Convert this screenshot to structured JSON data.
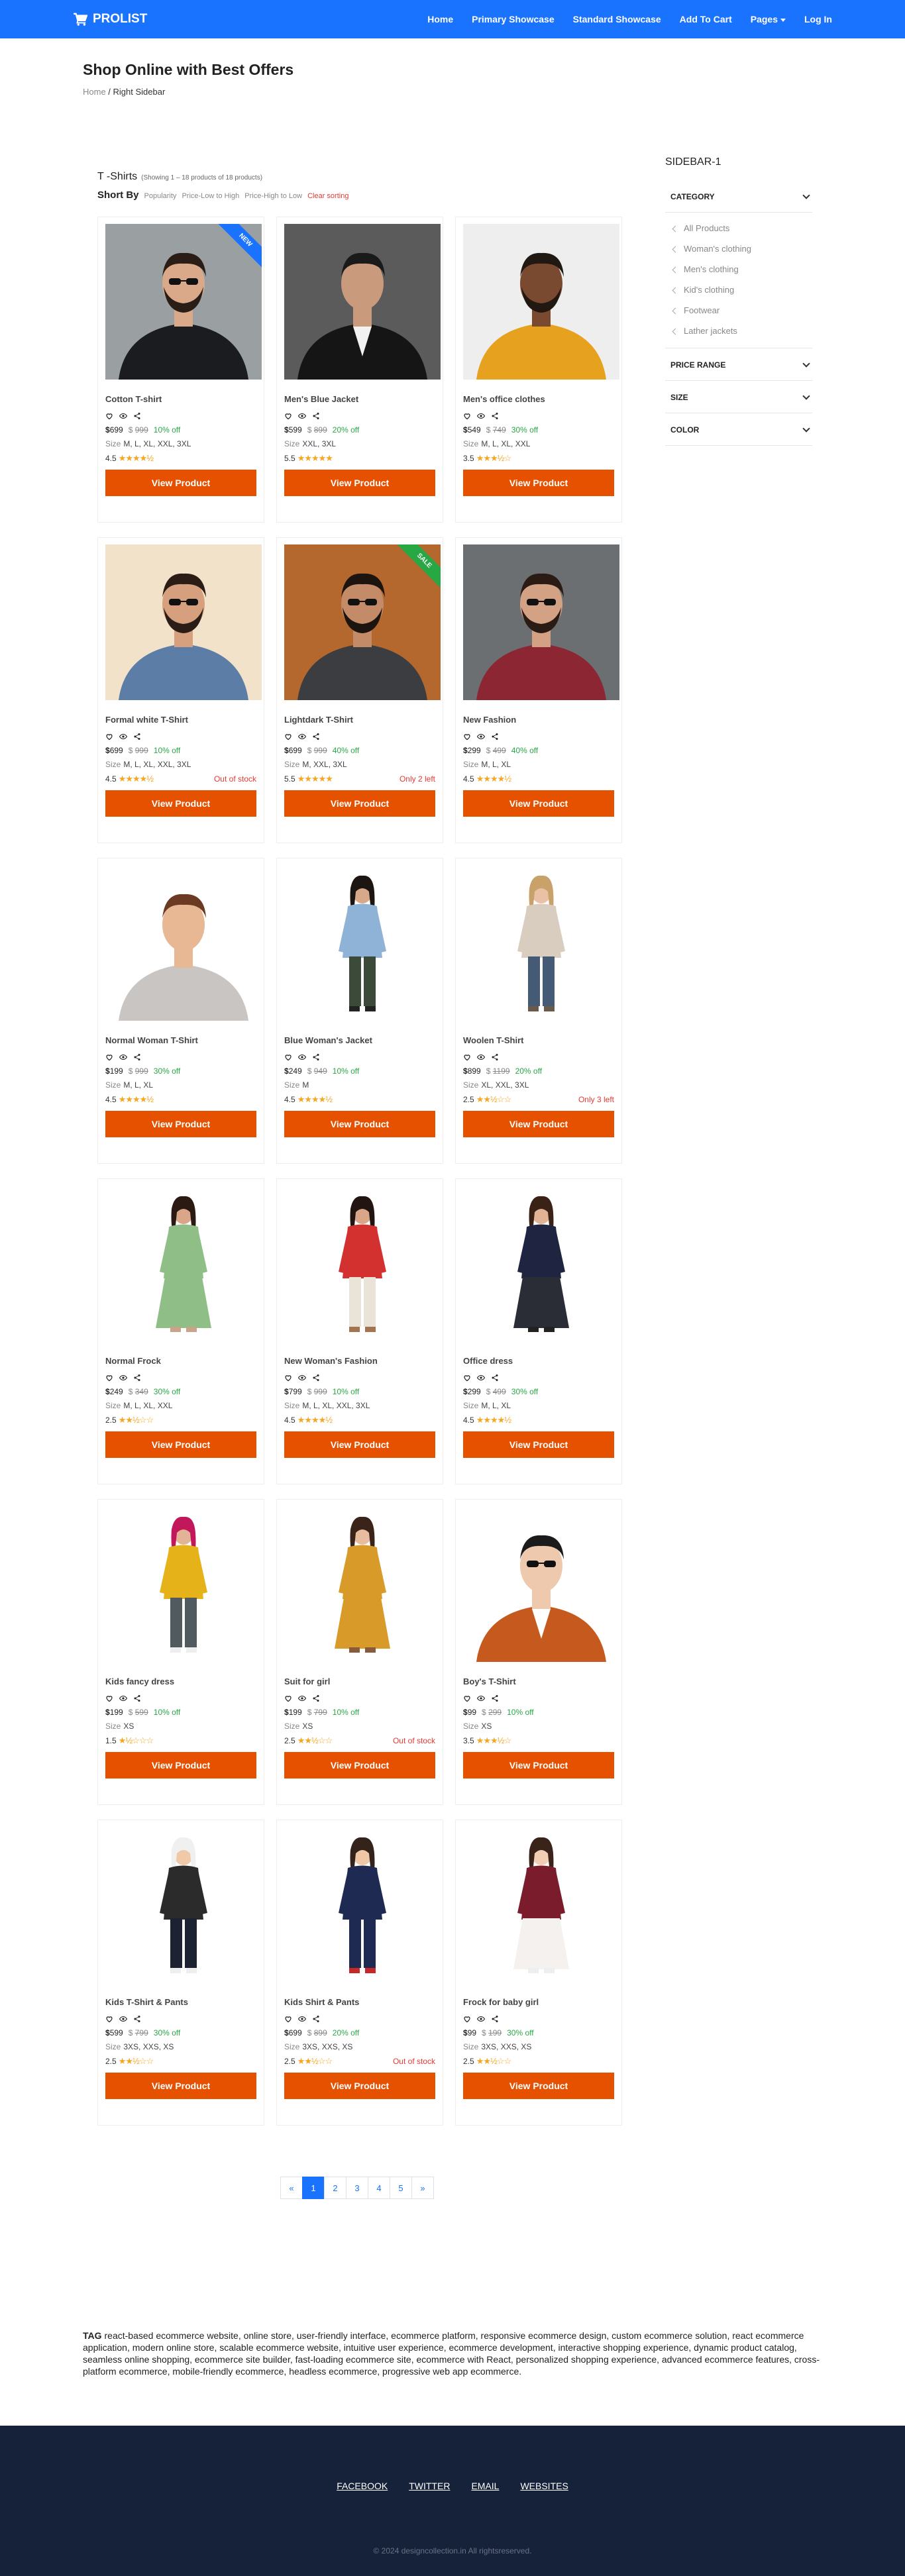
{
  "navbar": {
    "brand": "PROLIST",
    "links": [
      "Home",
      "Primary Showcase",
      "Standard Showcase",
      "Add To Cart",
      "Pages",
      "Log In"
    ]
  },
  "header": {
    "title": "Shop Online with Best Offers",
    "breadcrumb_home": "Home",
    "breadcrumb_sep": " / ",
    "breadcrumb_current": "Right Sidebar"
  },
  "listing": {
    "title": "T -Shirts",
    "count_text": "(Showing 1 – 18 products of 18 products)",
    "sort_label": "Short By",
    "sort_options": [
      "Popularity",
      "Price-Low to High",
      "Price-High to Low"
    ],
    "clear_label": "Clear sorting"
  },
  "colors": {
    "primary": "#1a73ff",
    "button": "#e65100",
    "off": "#28a745",
    "danger": "#e53935",
    "star": "#f5a623",
    "footer": "#16213a"
  },
  "products": [
    {
      "name": "Cotton T-shirt",
      "price": "699",
      "old": "999",
      "off": "10% off",
      "sizes": "M, L, XL, XXL, 3XL",
      "rating": "4.5",
      "stars": "★★★★½",
      "stock": "",
      "badge": "NEW",
      "img": "jacket-man"
    },
    {
      "name": "Men's Blue Jacket",
      "price": "599",
      "old": "899",
      "off": "20% off",
      "sizes": "XXL, 3XL",
      "rating": "5.5",
      "stars": "★★★★★",
      "stock": "",
      "badge": "",
      "img": "leather-man"
    },
    {
      "name": "Men's office clothes",
      "price": "549",
      "old": "749",
      "off": "30% off",
      "sizes": "M, L, XL, XXL",
      "rating": "3.5",
      "stars": "★★★½☆",
      "stock": "",
      "badge": "",
      "img": "yellow-man"
    },
    {
      "name": "Formal white T-Shirt",
      "price": "699",
      "old": "999",
      "off": "10% off",
      "sizes": "M, L, XL, XXL, 3XL",
      "rating": "4.5",
      "stars": "★★★★½",
      "stock": "Out of stock",
      "badge": "",
      "img": "denim-man"
    },
    {
      "name": "Lightdark T-Shirt",
      "price": "699",
      "old": "999",
      "off": "40% off",
      "sizes": "M, XXL, 3XL",
      "rating": "5.5",
      "stars": "★★★★★",
      "stock": "Only 2 left",
      "badge": "SALE",
      "img": "wood-man"
    },
    {
      "name": "New Fashion",
      "price": "299",
      "old": "499",
      "off": "40% off",
      "sizes": "M, L, XL",
      "rating": "4.5",
      "stars": "★★★★½",
      "stock": "",
      "badge": "",
      "img": "maroon-man"
    },
    {
      "name": "Normal Woman T-Shirt",
      "price": "199",
      "old": "999",
      "off": "30% off",
      "sizes": "M, L, XL",
      "rating": "4.5",
      "stars": "★★★★½",
      "stock": "",
      "badge": "",
      "img": "woman-grey"
    },
    {
      "name": "Blue Woman's Jacket",
      "price": "249",
      "old": "949",
      "off": "10% off",
      "sizes": "M",
      "rating": "4.5",
      "stars": "★★★★½",
      "stock": "",
      "badge": "",
      "img": "woman-denim"
    },
    {
      "name": "Woolen T-Shirt",
      "price": "899",
      "old": "1199",
      "off": "20% off",
      "sizes": "XL, XXL, 3XL",
      "rating": "2.5",
      "stars": "★★½☆☆",
      "stock": "Only 3 left",
      "badge": "",
      "img": "woman-beige"
    },
    {
      "name": "Normal Frock",
      "price": "249",
      "old": "349",
      "off": "30% off",
      "sizes": "M, L, XL, XXL",
      "rating": "2.5",
      "stars": "★★½☆☆",
      "stock": "",
      "badge": "",
      "img": "woman-green"
    },
    {
      "name": "New Woman's Fashion",
      "price": "799",
      "old": "999",
      "off": "10% off",
      "sizes": "M, L, XL, XXL, 3XL",
      "rating": "4.5",
      "stars": "★★★★½",
      "stock": "",
      "badge": "",
      "img": "woman-red"
    },
    {
      "name": "Office dress",
      "price": "299",
      "old": "499",
      "off": "30% off",
      "sizes": "M, L, XL",
      "rating": "4.5",
      "stars": "★★★★½",
      "stock": "",
      "badge": "",
      "img": "woman-navy"
    },
    {
      "name": "Kids fancy dress",
      "price": "199",
      "old": "599",
      "off": "10% off",
      "sizes": "XS",
      "rating": "1.5",
      "stars": "★½☆☆☆",
      "stock": "",
      "badge": "",
      "img": "kid-yellow"
    },
    {
      "name": "Suit for girl",
      "price": "199",
      "old": "799",
      "off": "10% off",
      "sizes": "XS",
      "rating": "2.5",
      "stars": "★★½☆☆",
      "stock": "Out of stock",
      "badge": "",
      "img": "kid-mustard"
    },
    {
      "name": "Boy's T-Shirt",
      "price": "99",
      "old": "299",
      "off": "10% off",
      "sizes": "XS",
      "rating": "3.5",
      "stars": "★★★½☆",
      "stock": "",
      "badge": "",
      "img": "kids-boys"
    },
    {
      "name": "Kids T-Shirt & Pants",
      "price": "599",
      "old": "799",
      "off": "30% off",
      "sizes": "3XS, XXS, XS",
      "rating": "2.5",
      "stars": "★★½☆☆",
      "stock": "",
      "badge": "",
      "img": "kid-stripe"
    },
    {
      "name": "Kids Shirt & Pants",
      "price": "699",
      "old": "899",
      "off": "20% off",
      "sizes": "3XS, XXS, XS",
      "rating": "2.5",
      "stars": "★★½☆☆",
      "stock": "Out of stock",
      "badge": "",
      "img": "kids-set"
    },
    {
      "name": "Frock for baby girl",
      "price": "99",
      "old": "199",
      "off": "30% off",
      "sizes": "3XS, XXS, XS",
      "rating": "2.5",
      "stars": "★★½☆☆",
      "stock": "",
      "badge": "",
      "img": "baby-frock"
    }
  ],
  "size_label": "Size",
  "currency": "$",
  "button_label": "View Product",
  "sidebar": {
    "title": "SIDEBAR-1",
    "category_label": "CATEGORY",
    "categories": [
      "All Products",
      "Woman's clothing",
      "Men's clothing",
      "Kid's clothing",
      "Footwear",
      "Lather jackets"
    ],
    "price_label": "PRICE RANGE",
    "size_label": "SIZE",
    "color_label": "COLOR"
  },
  "pagination": {
    "prev": "«",
    "pages": [
      "1",
      "2",
      "3",
      "4",
      "5"
    ],
    "next": "»",
    "active": "1"
  },
  "tags": {
    "label": "TAG",
    "text": "react-based ecommerce website, online store, user-friendly interface, ecommerce platform, responsive ecommerce design, custom ecommerce solution, react ecommerce application, modern online store, scalable ecommerce website, intuitive user experience, ecommerce development, interactive shopping experience, dynamic product catalog, seamless online shopping, ecommerce site builder, fast-loading ecommerce site, ecommerce with React, personalized shopping experience, advanced ecommerce features, cross-platform ecommerce, mobile-friendly ecommerce, headless ecommerce, progressive web app ecommerce."
  },
  "footer": {
    "links": [
      "FACEBOOK",
      "TWITTER",
      "EMAIL",
      "WEBSITES"
    ],
    "copyright": "© 2024 designcollection.in All rightsreserved."
  }
}
